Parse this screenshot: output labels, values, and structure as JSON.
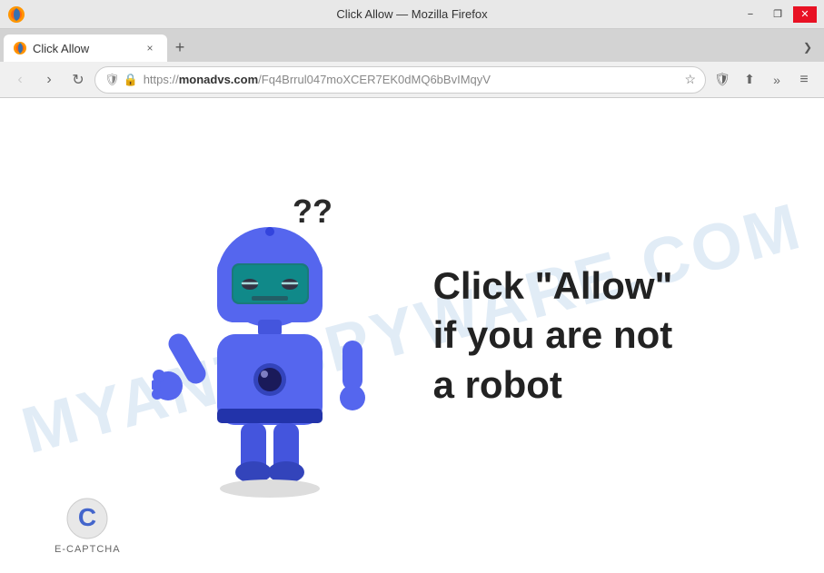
{
  "titlebar": {
    "title": "Click Allow — Mozilla Firefox",
    "minimize_label": "−",
    "restore_label": "❐",
    "close_label": "✕"
  },
  "tab": {
    "label": "Click Allow",
    "close_label": "×"
  },
  "new_tab_label": "+",
  "chevron_label": "❯",
  "toolbar": {
    "back_label": "‹",
    "forward_label": "›",
    "reload_label": "↻",
    "url_shield": "🛡",
    "url_lock": "🔒",
    "url_full": "https://monadvs.com/Fq4Brrul047moXCER7EK0dMQ6bBvIMqyV",
    "url_domain": "monadvs.com",
    "url_path": "/Fq4Brrul047moXCER7EK0dMQ6bBvIMqyV",
    "bookmark_label": "☆",
    "shield_btn": "⛨",
    "share_btn": "⬆",
    "more_btn": "»",
    "menu_btn": "≡"
  },
  "content": {
    "main_line1": "Click \"Allow\"",
    "main_line2": "if you are not",
    "main_line3": "a robot",
    "watermark": "MYANTISPYWARE.COM"
  },
  "ecaptcha": {
    "label": "E-CAPTCHA"
  }
}
